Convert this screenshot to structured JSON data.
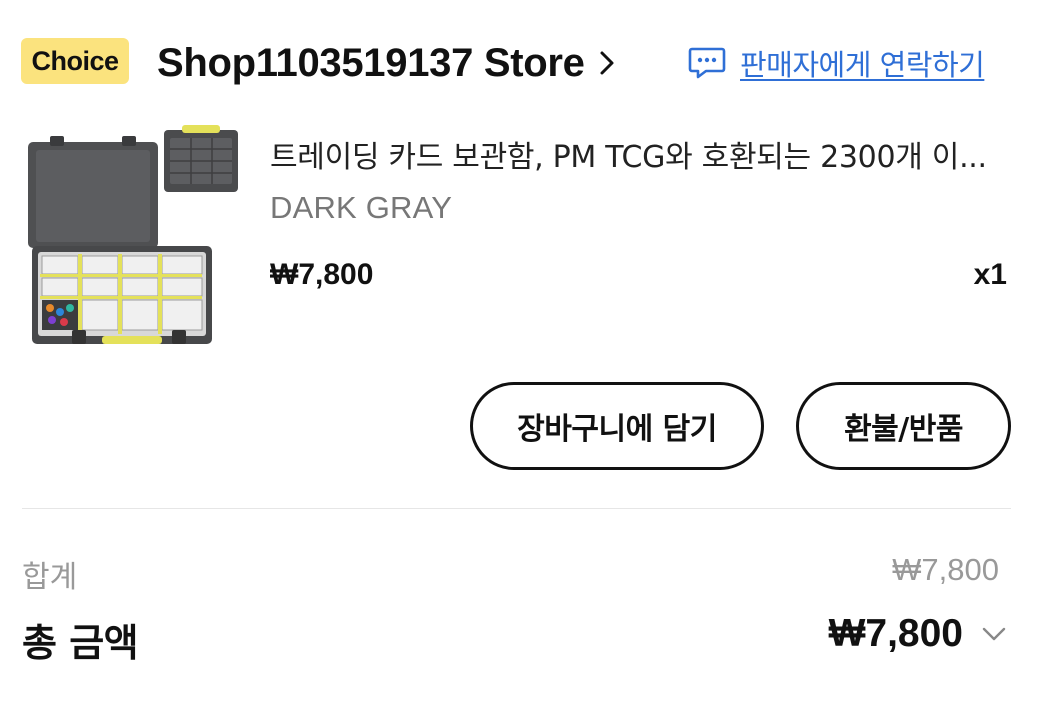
{
  "store": {
    "badge": "Choice",
    "name": "Shop1103519137 Store",
    "contact_label": "판매자에게 연락하기"
  },
  "product": {
    "title": "트레이딩 카드 보관함, PM TCG와 호환되는 2300개 이...",
    "variant": "DARK GRAY",
    "price": "₩7,800",
    "quantity": "x1"
  },
  "actions": {
    "add_to_cart": "장바구니에 담기",
    "refund": "환불/반품"
  },
  "summary": {
    "subtotal_label": "합계",
    "subtotal_value": "₩7,800",
    "total_label": "총 금액",
    "total_value": "₩7,800"
  },
  "colors": {
    "badge": "#fbe37e",
    "link": "#2f6fd6",
    "text": "#111111",
    "muted": "#999999"
  },
  "icons": {
    "store_chevron": "chevron-right-icon",
    "contact": "chat-icon",
    "total_toggle": "chevron-down-icon"
  }
}
